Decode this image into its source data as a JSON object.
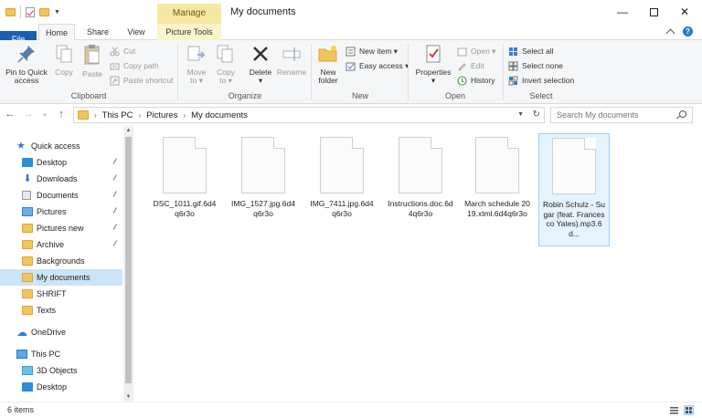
{
  "window": {
    "title": "My documents",
    "context_tab": "Manage",
    "minimize": "—",
    "close": "✕"
  },
  "tabs": {
    "file": "File",
    "home": "Home",
    "share": "Share",
    "view": "View",
    "picture_tools": "Picture Tools"
  },
  "ribbon": {
    "clipboard": {
      "label": "Clipboard",
      "pin": [
        "Pin to Quick",
        "access"
      ],
      "copy": "Copy",
      "paste": "Paste",
      "cut": "Cut",
      "copy_path": "Copy path",
      "paste_shortcut": "Paste shortcut"
    },
    "organize": {
      "label": "Organize",
      "move_to": [
        "Move",
        "to ▾"
      ],
      "copy_to": [
        "Copy",
        "to ▾"
      ],
      "delete": [
        "Delete",
        "▾"
      ],
      "rename": "Rename"
    },
    "new": {
      "label": "New",
      "new_folder": [
        "New",
        "folder"
      ],
      "new_item": "New item ▾",
      "easy_access": "Easy access ▾"
    },
    "open": {
      "label": "Open",
      "properties": [
        "Properties",
        "▾"
      ],
      "open": "Open ▾",
      "edit": "Edit",
      "history": "History"
    },
    "select": {
      "label": "Select",
      "select_all": "Select all",
      "select_none": "Select none",
      "invert": "Invert selection"
    }
  },
  "address": {
    "crumbs": [
      "This PC",
      "Pictures",
      "My documents"
    ],
    "search_placeholder": "Search My documents"
  },
  "nav": {
    "quick_access": "Quick access",
    "items": [
      {
        "label": "Desktop",
        "icon": "desktop-icon",
        "pinned": true
      },
      {
        "label": "Downloads",
        "icon": "downloads-icon",
        "pinned": true
      },
      {
        "label": "Documents",
        "icon": "documents-icon",
        "pinned": true
      },
      {
        "label": "Pictures",
        "icon": "pictures-icon",
        "pinned": true
      },
      {
        "label": "Pictures new",
        "icon": "folder-icon",
        "pinned": true
      },
      {
        "label": "Archive",
        "icon": "folder-icon",
        "pinned": true
      },
      {
        "label": "Backgrounds",
        "icon": "folder-icon",
        "pinned": false
      },
      {
        "label": "My documents",
        "icon": "folder-icon",
        "pinned": false,
        "selected": true
      },
      {
        "label": "SHRIFT",
        "icon": "folder-icon",
        "pinned": false
      },
      {
        "label": "Texts",
        "icon": "folder-icon",
        "pinned": false
      }
    ],
    "onedrive": "OneDrive",
    "this_pc": "This PC",
    "pc_items": [
      "3D Objects",
      "Desktop"
    ]
  },
  "files": [
    {
      "name": "DSC_1011.gif.6d4q6r3o"
    },
    {
      "name": "IMG_1527.jpg.6d4q6r3o"
    },
    {
      "name": "IMG_7411.jpg.6d4q6r3o"
    },
    {
      "name": "Instructions.doc.6d4q6r3o"
    },
    {
      "name": "March schedule 2019.xtml.6d4q6r3o"
    },
    {
      "name": "Robin Schulz - Sugar (feat. Francesco Yates).mp3.6d...",
      "selected": true
    }
  ],
  "status": {
    "count": "6 items"
  }
}
